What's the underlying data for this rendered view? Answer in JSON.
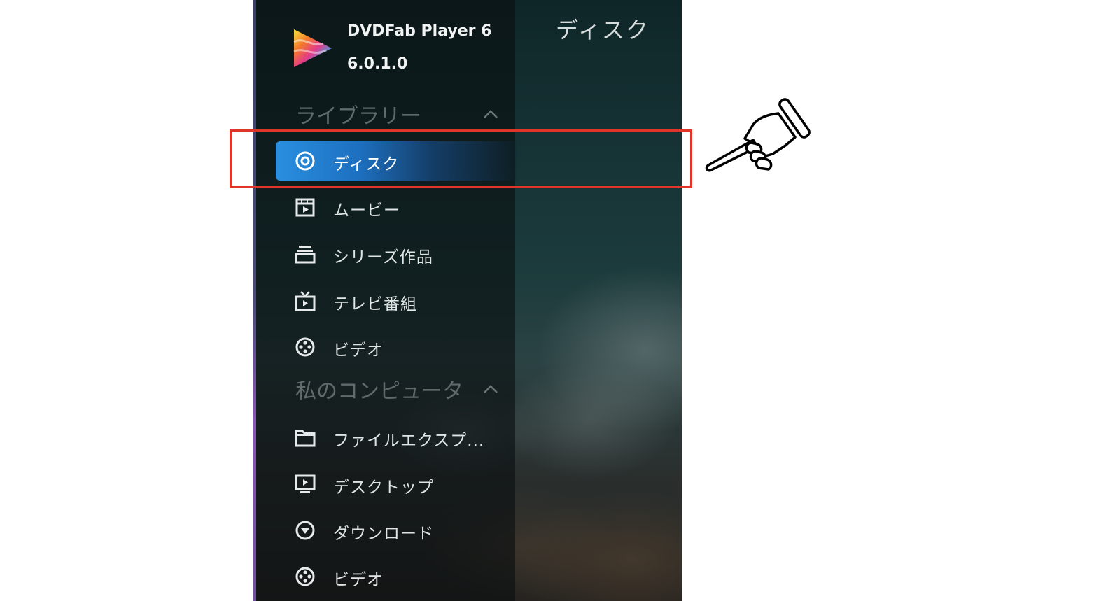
{
  "app": {
    "name": "DVDFab Player 6",
    "version": "6.0.1.0",
    "content_title": "ディスク"
  },
  "sidebar": {
    "sections": [
      {
        "header": "ライブラリー",
        "items": [
          {
            "label": "ディスク",
            "icon": "disc-icon",
            "active": true
          },
          {
            "label": "ムービー",
            "icon": "movie-icon",
            "active": false
          },
          {
            "label": "シリーズ作品",
            "icon": "series-stack-icon",
            "active": false
          },
          {
            "label": "テレビ番組",
            "icon": "tv-icon",
            "active": false
          },
          {
            "label": "ビデオ",
            "icon": "film-reel-icon",
            "active": false
          }
        ]
      },
      {
        "header": "私のコンピュータ",
        "items": [
          {
            "label": "ファイルエクスプ...",
            "icon": "folder-icon",
            "active": false
          },
          {
            "label": "デスクトップ",
            "icon": "monitor-icon",
            "active": false
          },
          {
            "label": "ダウンロード",
            "icon": "download-icon",
            "active": false
          },
          {
            "label": "ビデオ",
            "icon": "film-reel-icon",
            "active": false
          }
        ]
      }
    ]
  },
  "annotation": {
    "highlight_color": "#e0362a",
    "pointer": "pointing-hand-icon"
  },
  "colors": {
    "active_accent": "#2a8fe0",
    "sidebar_text": "#dfe4e4",
    "section_header": "#5f6a6c"
  }
}
